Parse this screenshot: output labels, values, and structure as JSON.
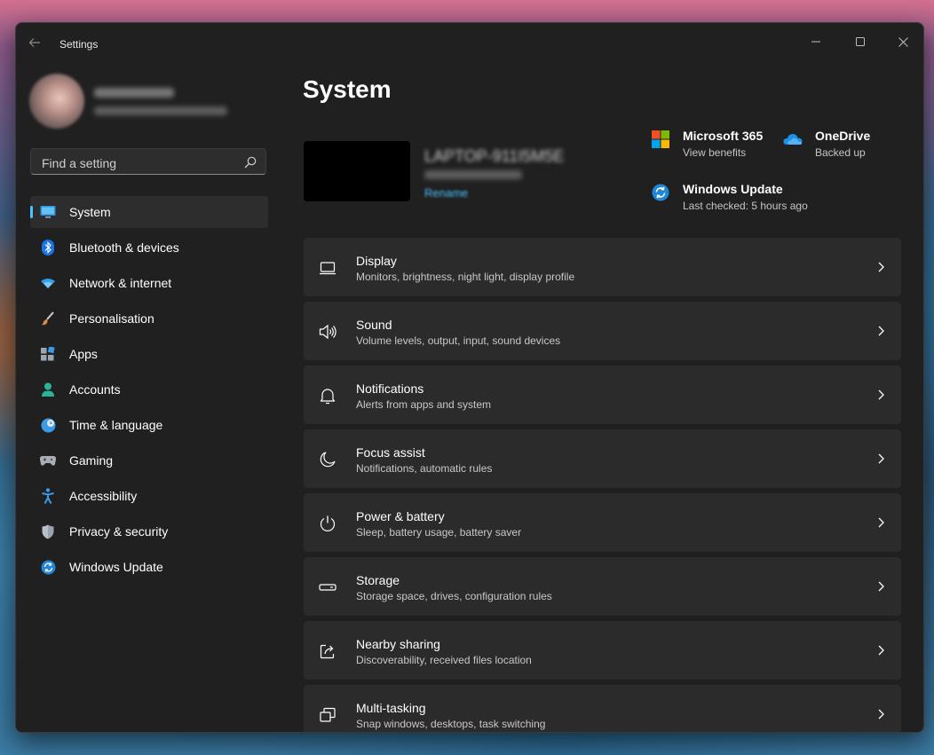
{
  "window": {
    "title": "Settings"
  },
  "search": {
    "placeholder": "Find a setting"
  },
  "sidebar": {
    "items": [
      {
        "label": "System",
        "icon": "system-icon"
      },
      {
        "label": "Bluetooth & devices",
        "icon": "bluetooth-icon"
      },
      {
        "label": "Network & internet",
        "icon": "wifi-icon"
      },
      {
        "label": "Personalisation",
        "icon": "brush-icon"
      },
      {
        "label": "Apps",
        "icon": "apps-icon"
      },
      {
        "label": "Accounts",
        "icon": "person-icon"
      },
      {
        "label": "Time & language",
        "icon": "globe-clock-icon"
      },
      {
        "label": "Gaming",
        "icon": "gamepad-icon"
      },
      {
        "label": "Accessibility",
        "icon": "accessibility-icon"
      },
      {
        "label": "Privacy & security",
        "icon": "shield-icon"
      },
      {
        "label": "Windows Update",
        "icon": "update-icon"
      }
    ],
    "selected": "System"
  },
  "main": {
    "title": "System",
    "device": {
      "name": "LAPTOP-911I5M5E",
      "rename_label": "Rename"
    },
    "quick_links": [
      {
        "title": "Microsoft 365",
        "subtitle": "View benefits",
        "icon": "microsoft-logo-icon"
      },
      {
        "title": "OneDrive",
        "subtitle": "Backed up",
        "icon": "cloud-icon"
      },
      {
        "title": "Windows Update",
        "subtitle": "Last checked: 5 hours ago",
        "icon": "update-icon"
      }
    ],
    "cards": [
      {
        "title": "Display",
        "subtitle": "Monitors, brightness, night light, display profile",
        "icon": "display-icon"
      },
      {
        "title": "Sound",
        "subtitle": "Volume levels, output, input, sound devices",
        "icon": "speaker-icon"
      },
      {
        "title": "Notifications",
        "subtitle": "Alerts from apps and system",
        "icon": "bell-icon"
      },
      {
        "title": "Focus assist",
        "subtitle": "Notifications, automatic rules",
        "icon": "moon-icon"
      },
      {
        "title": "Power & battery",
        "subtitle": "Sleep, battery usage, battery saver",
        "icon": "power-icon"
      },
      {
        "title": "Storage",
        "subtitle": "Storage space, drives, configuration rules",
        "icon": "storage-icon"
      },
      {
        "title": "Nearby sharing",
        "subtitle": "Discoverability, received files location",
        "icon": "share-icon"
      },
      {
        "title": "Multi-tasking",
        "subtitle": "Snap windows, desktops, task switching",
        "icon": "multitask-icon"
      }
    ]
  },
  "colors": {
    "accent": "#4cc2ff",
    "window_bg": "#202020",
    "card_bg": "#2b2b2b"
  }
}
